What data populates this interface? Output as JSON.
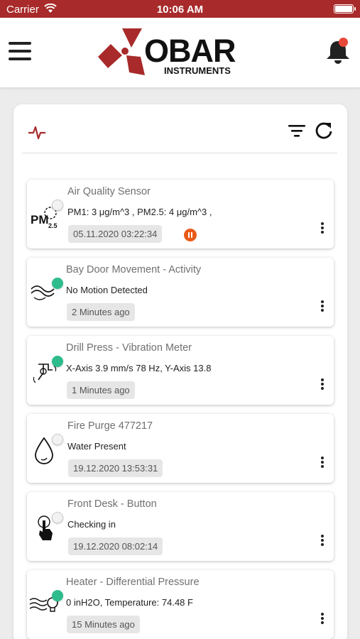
{
  "status_bar": {
    "carrier": "Carrier",
    "time": "10:06 AM"
  },
  "header": {
    "logo_word": "OBAR",
    "logo_sub": "INSTRUMENTS",
    "logo_color": "#a82a2a",
    "notification_dot_color": "#e8483a"
  },
  "toolbar": {
    "activity_icon": "activity-icon",
    "filter_icon": "filter-icon",
    "refresh_icon": "refresh-icon"
  },
  "sensors": [
    {
      "title": "Air Quality Sensor",
      "reading": "PM1: 3 μg/m^3 , PM2.5: 4 μg/m^3 ,",
      "timestamp": "05.11.2020 03:22:34",
      "icon": "pm25-icon",
      "online": false,
      "paused": true
    },
    {
      "title": "Bay Door Movement - Activity",
      "reading": "No Motion Detected",
      "timestamp": "2 Minutes ago",
      "icon": "motion-icon",
      "online": true,
      "paused": false
    },
    {
      "title": "Drill Press - Vibration Meter",
      "reading": "X-Axis 3.9 mm/s 78 Hz, Y-Axis 13.8",
      "timestamp": "1 Minutes ago",
      "icon": "vibration-icon",
      "online": true,
      "paused": false
    },
    {
      "title": "Fire Purge 477217",
      "reading": "Water Present",
      "timestamp": "19.12.2020 13:53:31",
      "icon": "water-drop-icon",
      "online": false,
      "paused": false
    },
    {
      "title": "Front Desk - Button",
      "reading": "Checking in",
      "timestamp": "19.12.2020 08:02:14",
      "icon": "button-press-icon",
      "online": false,
      "paused": false
    },
    {
      "title": "Heater - Differential Pressure",
      "reading": "0 inH2O, Temperature: 74.48 F",
      "timestamp": "15 Minutes ago",
      "icon": "pressure-icon",
      "online": true,
      "paused": false
    }
  ],
  "colors": {
    "online": "#2fbc8c",
    "pause": "#ea5b17",
    "header_bar": "#a82a2a"
  }
}
